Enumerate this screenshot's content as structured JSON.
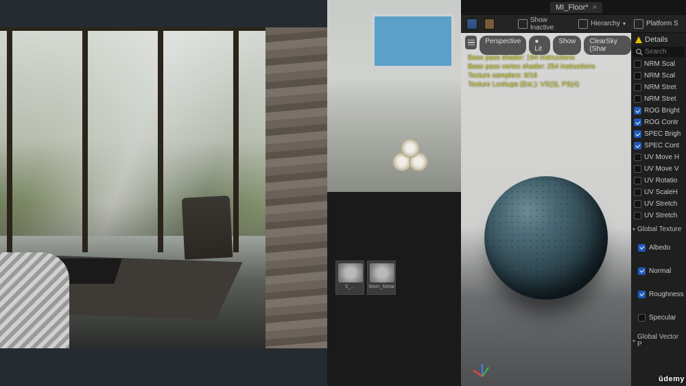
{
  "tab": {
    "title": "MI_Floor*",
    "dirty": true
  },
  "toolbar": {
    "show_inactive": "Show Inactive",
    "hierarchy": "Hierarchy",
    "platform": "Platform S"
  },
  "viewport": {
    "buttons": {
      "perspective": "Perspective",
      "lit": "Lit",
      "show": "Show",
      "sky": "ClearSky (Shar"
    },
    "shader_info": [
      "Base pass shader: 194 instructions",
      "Base pass vertex shader: 254 instructions",
      "Texture samplers: 6/16",
      "Texture Lookups (Est.): VS(3), PS(4)"
    ]
  },
  "details": {
    "title": "Details",
    "search_placeholder": "Search",
    "switch_params": [
      {
        "label": "NRM Scal",
        "on": false
      },
      {
        "label": "NRM Scal",
        "on": false
      },
      {
        "label": "NRM Stret",
        "on": false
      },
      {
        "label": "NRM Stret",
        "on": false
      },
      {
        "label": "ROG Bright",
        "on": true
      },
      {
        "label": "ROG Contr",
        "on": true
      },
      {
        "label": "SPEC Brigh",
        "on": true
      },
      {
        "label": "SPEC Cont",
        "on": true
      },
      {
        "label": "UV Move H",
        "on": false
      },
      {
        "label": "UV Move V",
        "on": false
      },
      {
        "label": "UV Rotatio",
        "on": false
      },
      {
        "label": "UV ScaleH",
        "on": false
      },
      {
        "label": "UV Stretch",
        "on": false
      },
      {
        "label": "UV Stretch",
        "on": false
      }
    ],
    "group_texture": "Global Texture",
    "tex_params": [
      {
        "label": "Albedo",
        "on": true
      },
      {
        "label": "Normal",
        "on": true
      },
      {
        "label": "Roughness",
        "on": true
      },
      {
        "label": "Specular",
        "on": false
      }
    ],
    "group_vector": "Global Vector P"
  },
  "thumbs": [
    {
      "label": "S_..."
    },
    {
      "label": "Worn_Metal"
    }
  ],
  "watermark": "ûdemy"
}
